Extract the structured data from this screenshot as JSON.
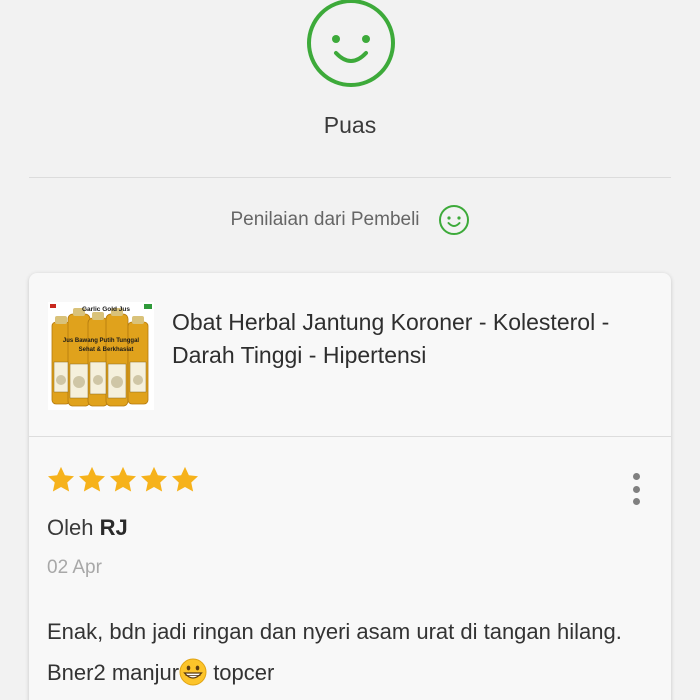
{
  "rating": {
    "label": "Puas",
    "accent_color": "#3daa3a"
  },
  "section": {
    "buyer_rating_label": "Penilaian dari Pembeli"
  },
  "product": {
    "title": "Obat Herbal Jantung Koroner - Kolesterol - Darah Tinggi - Hipertensi",
    "image_text": {
      "brand": "Garlic Gold Jus",
      "line1": "Jus Bawang Putih Tunggal",
      "line2": "Sehat & Berkhasiat"
    }
  },
  "review": {
    "stars": 5,
    "star_color": "#f6b21b",
    "by_prefix": "Oleh",
    "author": "RJ",
    "date": "02 Apr",
    "text_before_emoji": "Enak, bdn jadi ringan dan nyeri asam urat di tangan hilang. Bner2 manjur",
    "emoji_icon": "grinning-face-icon",
    "text_after_emoji": " topcer"
  },
  "icons": {
    "top": "smiley-icon",
    "inline": "smiley-small-icon",
    "menu": "more-vertical-icon"
  }
}
